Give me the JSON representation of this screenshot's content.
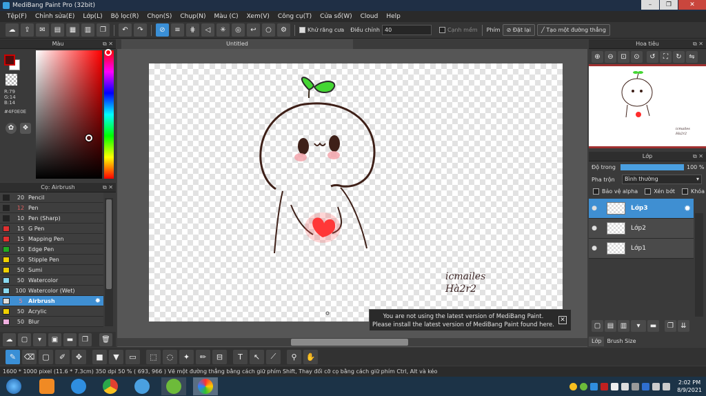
{
  "window": {
    "title": "MediBang Paint Pro (32bit)"
  },
  "menu": [
    "Tệp(F)",
    "Chỉnh sửa(E)",
    "Lớp(L)",
    "Bộ lọc(R)",
    "Chọn(S)",
    "Chụp(N)",
    "Màu (C)",
    "Xem(V)",
    "Công cụ(T)",
    "Cửa sổ(W)",
    "Cloud",
    "Help"
  ],
  "toolbar": {
    "antialias_label": "Khử răng cưa",
    "adjust_label": "Điều chỉnh",
    "adjust_value": "40",
    "edge_label": "Cạnh mềm",
    "phim_label": "Phím",
    "reset_label": "Đặt lại",
    "line_label": "Tạo một đường thẳng"
  },
  "color_panel": {
    "title": "Màu",
    "r": "R:79",
    "g": "G:14",
    "b": "B:14",
    "hex": "#4F0E0E",
    "primary_color": "#4F0E0E"
  },
  "brush_panel": {
    "title": "Cọ: Airbrush",
    "brushes": [
      {
        "size": "20",
        "name": "Pencil",
        "color": "#222222"
      },
      {
        "size": "12",
        "name": "Pen",
        "color": "#222222"
      },
      {
        "size": "10",
        "name": "Pen (Sharp)",
        "color": "#222222"
      },
      {
        "size": "15",
        "name": "G Pen",
        "color": "#e03030"
      },
      {
        "size": "15",
        "name": "Mapping Pen",
        "color": "#e03030"
      },
      {
        "size": "10",
        "name": "Edge Pen",
        "color": "#22aa22"
      },
      {
        "size": "50",
        "name": "Stipple Pen",
        "color": "#f0d000"
      },
      {
        "size": "50",
        "name": "Sumi",
        "color": "#f0d000"
      },
      {
        "size": "50",
        "name": "Watercolor",
        "color": "#88d8f0"
      },
      {
        "size": "100",
        "name": "Watercolor (Wet)",
        "color": "#88d8f0"
      },
      {
        "size": "5",
        "name": "Airbrush",
        "color": "#dddddd",
        "selected": true
      },
      {
        "size": "50",
        "name": "Acrylic",
        "color": "#f0d000"
      },
      {
        "size": "50",
        "name": "Blur",
        "color": "#f0b0e0"
      }
    ]
  },
  "document": {
    "tab": "Untitled",
    "signature": "icmailes Hà2r2"
  },
  "notification": {
    "line1": "You are not using the latest version of MediBang Paint.",
    "line2": "Please install the latest version of MediBang Paint found here."
  },
  "navigator": {
    "title": "Hoa tiêu"
  },
  "layer_panel": {
    "title": "Lớp",
    "opacity_label": "Độ trong",
    "opacity_value": "100 %",
    "opacity": 1.0,
    "blend_label": "Pha trộn",
    "blend_value": "Bình thường",
    "protect_alpha": "Bảo vệ alpha",
    "clipping": "Xén bớt",
    "lock": "Khóa",
    "layers": [
      {
        "name": "Lớp3",
        "selected": true
      },
      {
        "name": "Lớp2",
        "selected": false
      },
      {
        "name": "Lớp1",
        "selected": false
      }
    ],
    "tab_layer": "Lớp",
    "tab_brush_size": "Brush Size"
  },
  "status": {
    "text": "1600 * 1000 pixel   (11.6 * 7.3cm)   350 dpi   50 %   ( 693, 966 )   Vẽ một đường thẳng bằng cách giữ phím Shift, Thay đổi cỡ cọ bằng cách giữ phím Ctrl, Alt và kéo"
  },
  "taskbar": {
    "time": "2:02 PM",
    "date": "8/9/2021"
  }
}
